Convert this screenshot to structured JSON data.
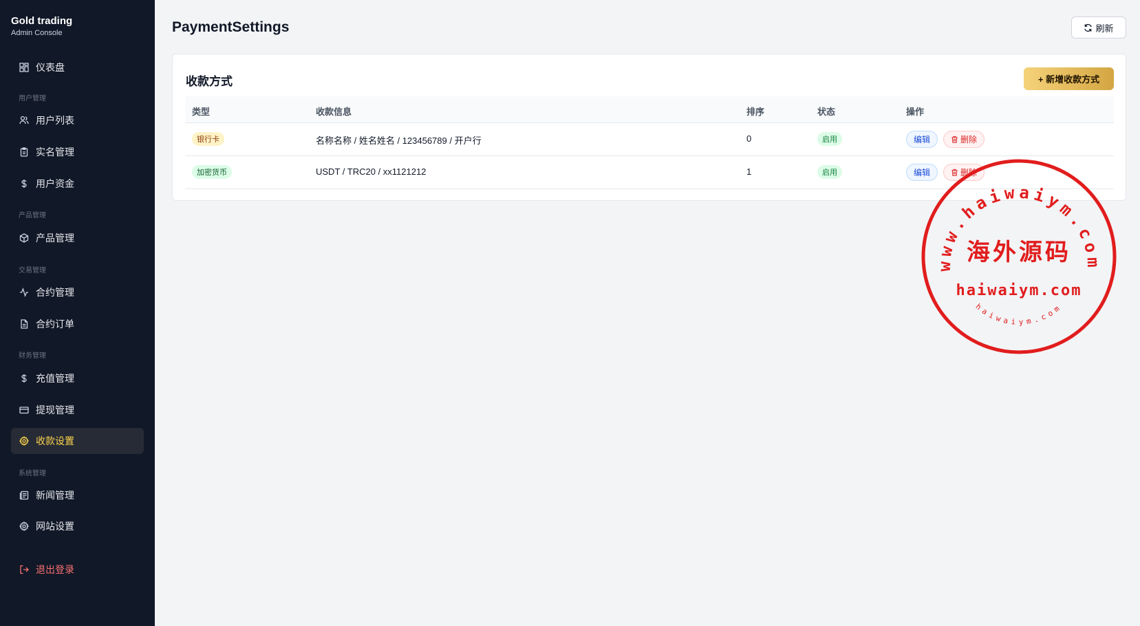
{
  "brand": {
    "title": "Gold trading",
    "subtitle": "Admin Console"
  },
  "nav": {
    "dashboard": "仪表盘",
    "section_users": "用户管理",
    "user_list": "用户列表",
    "kyc": "实名管理",
    "user_funds": "用户资金",
    "section_products": "产品管理",
    "products": "产品管理",
    "section_trading": "交易管理",
    "contracts": "合约管理",
    "contract_orders": "合约订单",
    "section_finance": "财务管理",
    "deposits": "充值管理",
    "withdrawals": "提现管理",
    "payment_settings": "收款设置",
    "section_system": "系统管理",
    "news": "新闻管理",
    "site_settings": "网站设置",
    "logout": "退出登录"
  },
  "header": {
    "title": "PaymentSettings",
    "refresh_label": "刷新"
  },
  "card": {
    "title": "收款方式",
    "add_label": "+ 新增收款方式"
  },
  "table": {
    "columns": [
      "类型",
      "收款信息",
      "排序",
      "状态",
      "操作"
    ],
    "rows": [
      {
        "type": "银行卡",
        "info": "名称名称 / 姓名姓名 / 123456789 / 开户行",
        "sort": "0",
        "status": "启用",
        "edit": "编辑",
        "delete": "删除"
      },
      {
        "type": "加密货币",
        "info": "USDT / TRC20 / xx1121212",
        "sort": "1",
        "status": "启用",
        "edit": "编辑",
        "delete": "删除"
      }
    ]
  },
  "watermark": {
    "arc_text": "www.haiwaiym.com",
    "main_text": "海外源码",
    "domain_text": "haiwaiym.com",
    "bottom_arc_text": "haiwaiym.com",
    "color": "#e11d1d"
  }
}
